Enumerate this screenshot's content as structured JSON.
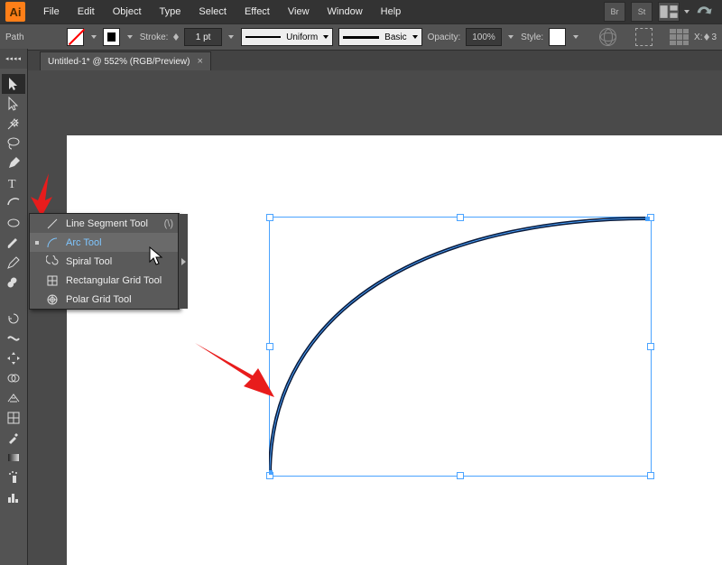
{
  "app": {
    "logo": "Ai"
  },
  "menu": [
    "File",
    "Edit",
    "Object",
    "Type",
    "Select",
    "Effect",
    "View",
    "Window",
    "Help"
  ],
  "top_icons": [
    "Br",
    "St"
  ],
  "ctrl": {
    "path_label": "Path",
    "stroke_label": "Stroke:",
    "stroke_value": "1 pt",
    "profile_label": "Uniform",
    "brush_label": "Basic",
    "opacity_label": "Opacity:",
    "opacity_value": "100%",
    "style_label": "Style:",
    "x_label": "X:",
    "x_value": "3"
  },
  "tab": {
    "title": "Untitled-1* @ 552% (RGB/Preview)",
    "close": "×",
    "panel_hint": "◂◂◂◂"
  },
  "flyout": {
    "items": [
      {
        "label": "Line Segment Tool",
        "shortcut": "(\\)",
        "selected": false
      },
      {
        "label": "Arc Tool",
        "shortcut": "",
        "selected": true
      },
      {
        "label": "Spiral Tool",
        "shortcut": "",
        "selected": false
      },
      {
        "label": "Rectangular Grid Tool",
        "shortcut": "",
        "selected": false
      },
      {
        "label": "Polar Grid Tool",
        "shortcut": "",
        "selected": false
      }
    ]
  },
  "tools": [
    "selection",
    "direct-selection",
    "magic-wand",
    "lasso",
    "pen",
    "type",
    "line-segment",
    "rectangle",
    "paintbrush",
    "pencil",
    "blob-brush",
    "rotate",
    "width",
    "free-transform",
    "shape-builder",
    "perspective-grid",
    "mesh",
    "eyedropper",
    "gradient",
    "symbol-sprayer",
    "column-graph"
  ]
}
